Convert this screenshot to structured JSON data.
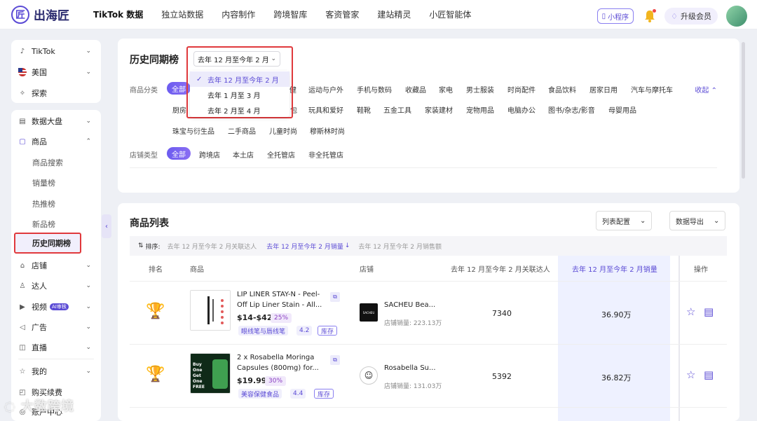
{
  "brand": {
    "name": "出海匠",
    "mark": "匠"
  },
  "nav": [
    "TikTok 数据",
    "独立站数据",
    "内容制作",
    "跨境智库",
    "客资管家",
    "建站精灵",
    "小匠智能体"
  ],
  "top_right": {
    "mini_program": "小程序",
    "upgrade": "升级会员"
  },
  "sidebar": {
    "platform": "TikTok",
    "region": "美国",
    "explore": "探索",
    "dashboard": "数据大盘",
    "goods": "商品",
    "goods_sub": [
      "商品搜索",
      "销量榜",
      "热推榜",
      "新品榜"
    ],
    "active": "历史同期榜",
    "store": "店铺",
    "creator": "达人",
    "video": "视频",
    "video_badge": "AI审核",
    "ads": "广告",
    "live": "直播",
    "mine": "我的",
    "purchase": "购买续费",
    "account": "账户中心"
  },
  "watermark": "大数跨境",
  "filter": {
    "title": "历史同期榜",
    "selected_period": "去年 12 月至今年 2 月",
    "period_options": [
      "去年 12 月至今年 2 月",
      "去年 1 月至 3 月",
      "去年 2 月至 4 月"
    ],
    "category_label": "商品分类",
    "all": "全部",
    "categories_row1": [
      "运动与户外",
      "手机与数码",
      "收藏品",
      "家电",
      "男士服装",
      "时尚配件",
      "食品饮料",
      "居家日用",
      "汽车与摩托车"
    ],
    "categories_row1_fragment": "健",
    "categories_row2": [
      "玩具和爱好",
      "鞋靴",
      "五金工具",
      "家装建材",
      "宠物用品",
      "电脑办公",
      "图书/杂志/影音",
      "母婴用品"
    ],
    "categories_row2_fragment_left": "厨房",
    "categories_row2_fragment_right": "包",
    "categories_row3": [
      "珠宝与衍生品",
      "二手商品",
      "儿童时尚",
      "穆斯林时尚"
    ],
    "collapse": "收起",
    "store_type_label": "店铺类型",
    "store_types": [
      "跨境店",
      "本土店",
      "全托管店",
      "非全托管店"
    ]
  },
  "list": {
    "title": "商品列表",
    "config_button": "列表配置",
    "export_button": "数据导出",
    "sort_label": "排序:",
    "sort_options": [
      "去年 12 月至今年 2 月关联达人",
      "去年 12 月至今年 2 月销量",
      "去年 12 月至今年 2 月销售额"
    ],
    "columns": [
      "排名",
      "商品",
      "店铺",
      "去年 12 月至今年 2 月关联达人",
      "去年 12 月至今年 2 月销量",
      "操作"
    ],
    "rows": [
      {
        "name": "LIP LINER STAY-N - Peel-Off Lip Liner Stain - All...",
        "price": "$14-$42",
        "discount": "25%",
        "tag": "眼线笔与唇线笔",
        "rating": "4.2",
        "stock": "库存",
        "store": "SACHEU Bea...",
        "store_sales": "店铺销量: 223.13万",
        "creators": "7340",
        "sales": "36.90万"
      },
      {
        "name": "2 x Rosabella Moringa Capsules (800mg) for...",
        "price": "$19.99",
        "discount": "30%",
        "tag": "美容保健食品",
        "rating": "4.4",
        "stock": "库存",
        "store": "Rosabella Su...",
        "store_sales": "店铺销量: 131.03万",
        "creators": "5392",
        "sales": "36.82万"
      }
    ],
    "store_logo_text": "SACHEU",
    "product2_img_text": "Buy One Get One FREE"
  }
}
